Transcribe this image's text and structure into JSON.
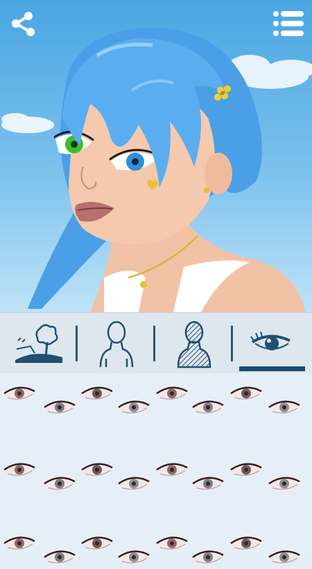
{
  "app": {
    "share_icon": "share-icon",
    "menu_icon": "list-menu-icon"
  },
  "tabs": [
    {
      "id": "background",
      "icon": "landscape-icon",
      "active": false
    },
    {
      "id": "body",
      "icon": "silhouette-outline-icon",
      "active": false
    },
    {
      "id": "clothing",
      "icon": "silhouette-hatched-icon",
      "active": false
    },
    {
      "id": "eyes",
      "icon": "eye-icon",
      "active": true
    }
  ],
  "eye_options": {
    "rows": 3,
    "columns": 8,
    "count": 24
  },
  "colors": {
    "accent": "#174a6c",
    "tab_bar": "#dfe7ee",
    "grid_bg": "#e6eff7",
    "sky": "#5ab1e8",
    "hair": "#5aaef0",
    "left_eye": "#3bbf2e",
    "right_eye": "#2f8fd8"
  }
}
